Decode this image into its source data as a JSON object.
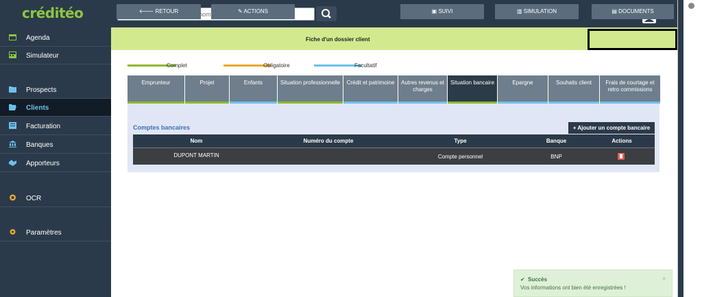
{
  "app": {
    "logo": "créditéo"
  },
  "search": {
    "placeholder": "Rechercher par n° dossier / nom / prénom / n° tel"
  },
  "sidebar": {
    "items": [
      {
        "label": "Agenda",
        "icon": "calendar-icon"
      },
      {
        "label": "Simulateur",
        "icon": "calculator-icon"
      },
      {
        "label": "Prospects",
        "icon": "folder-icon"
      },
      {
        "label": "Clients",
        "icon": "folder-open-icon",
        "active": true
      },
      {
        "label": "Facturation",
        "icon": "invoice-icon"
      },
      {
        "label": "Banques",
        "icon": "bank-icon"
      },
      {
        "label": "Apporteurs",
        "icon": "handshake-icon"
      },
      {
        "label": "OCR",
        "icon": "ocr-icon"
      },
      {
        "label": "Paramètres",
        "icon": "gear-icon"
      }
    ]
  },
  "actionbar": {
    "retour": "RETOUR",
    "actions": "ACTIONS",
    "title": "Fiche d'un dossier client",
    "suivi": "SUIVI",
    "simulation": "SIMULATION",
    "documents": "DOCUMENTS"
  },
  "legend": {
    "complet": "Complet",
    "obligatoire": "Obligatoire",
    "facultatif": "Facultatif"
  },
  "colors": {
    "complet": "#8db92e",
    "obligatoire": "#e9a82d",
    "facultatif": "#6cc1ea",
    "accent": "#8dc63f"
  },
  "tabs": [
    {
      "label": "Emprunteur",
      "status": "complet"
    },
    {
      "label": "Projet",
      "status": "complet"
    },
    {
      "label": "Enfants",
      "status": "facultatif"
    },
    {
      "label": "Situation professionnelle",
      "status": "complet"
    },
    {
      "label": "Crédit et patrimoine",
      "status": "facultatif"
    },
    {
      "label": "Autres revenus et charges",
      "status": "facultatif"
    },
    {
      "label": "Situation bancaire",
      "status": "complet",
      "active": true
    },
    {
      "label": "Epargne",
      "status": "facultatif"
    },
    {
      "label": "Souhaits client",
      "status": "facultatif"
    },
    {
      "label": "Frais de courtage et retro commissions",
      "status": "facultatif"
    }
  ],
  "comptes": {
    "title": "Comptes bancaires",
    "add_label": "Ajouter un compte bancaire",
    "columns": [
      "Nom",
      "Numéro du compte",
      "Type",
      "Banque",
      "Actions"
    ],
    "rows": [
      {
        "nom": "DUPONT MARTIN",
        "numero": "",
        "type": "Compte personnel",
        "banque": "BNP"
      }
    ]
  },
  "toast": {
    "title": "Succès",
    "message": "Vos informations ont bien été enregistrées !",
    "close": "×"
  }
}
